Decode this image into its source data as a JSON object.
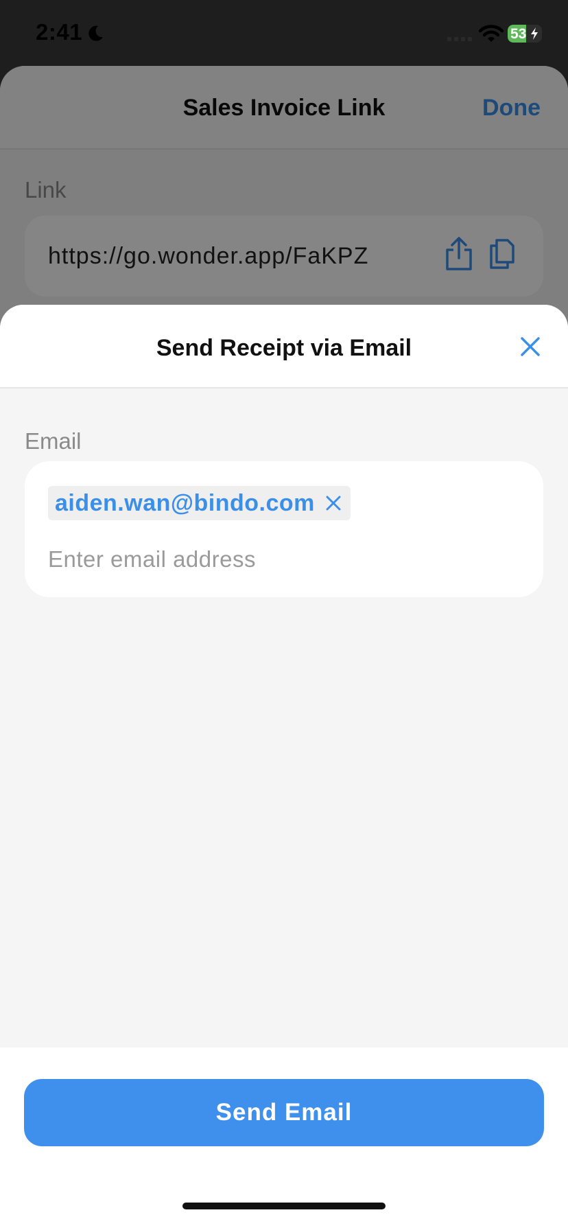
{
  "status_bar": {
    "time": "2:41",
    "battery": "53",
    "battery_level": 0.53,
    "icons": [
      "moon-icon",
      "signal-icon",
      "wifi-icon",
      "battery-icon",
      "bolt-icon"
    ]
  },
  "background_sheet": {
    "title": "Sales Invoice Link",
    "done_label": "Done",
    "link_label": "Link",
    "link_url": "https://go.wonder.app/FaKPZ",
    "icons": [
      "share-icon",
      "copy-icon"
    ]
  },
  "modal": {
    "title": "Send Receipt via Email",
    "email_label": "Email",
    "email_chips": [
      "aiden.wan@bindo.com"
    ],
    "email_placeholder": "Enter email address",
    "send_button_label": "Send Email",
    "icons": [
      "close-icon",
      "chip-remove-icon"
    ]
  },
  "colors": {
    "accent": "#3f90ec",
    "link_blue": "#3b8fe8",
    "battery_green": "#5fb85a",
    "modal_background": "#f5f5f5"
  }
}
